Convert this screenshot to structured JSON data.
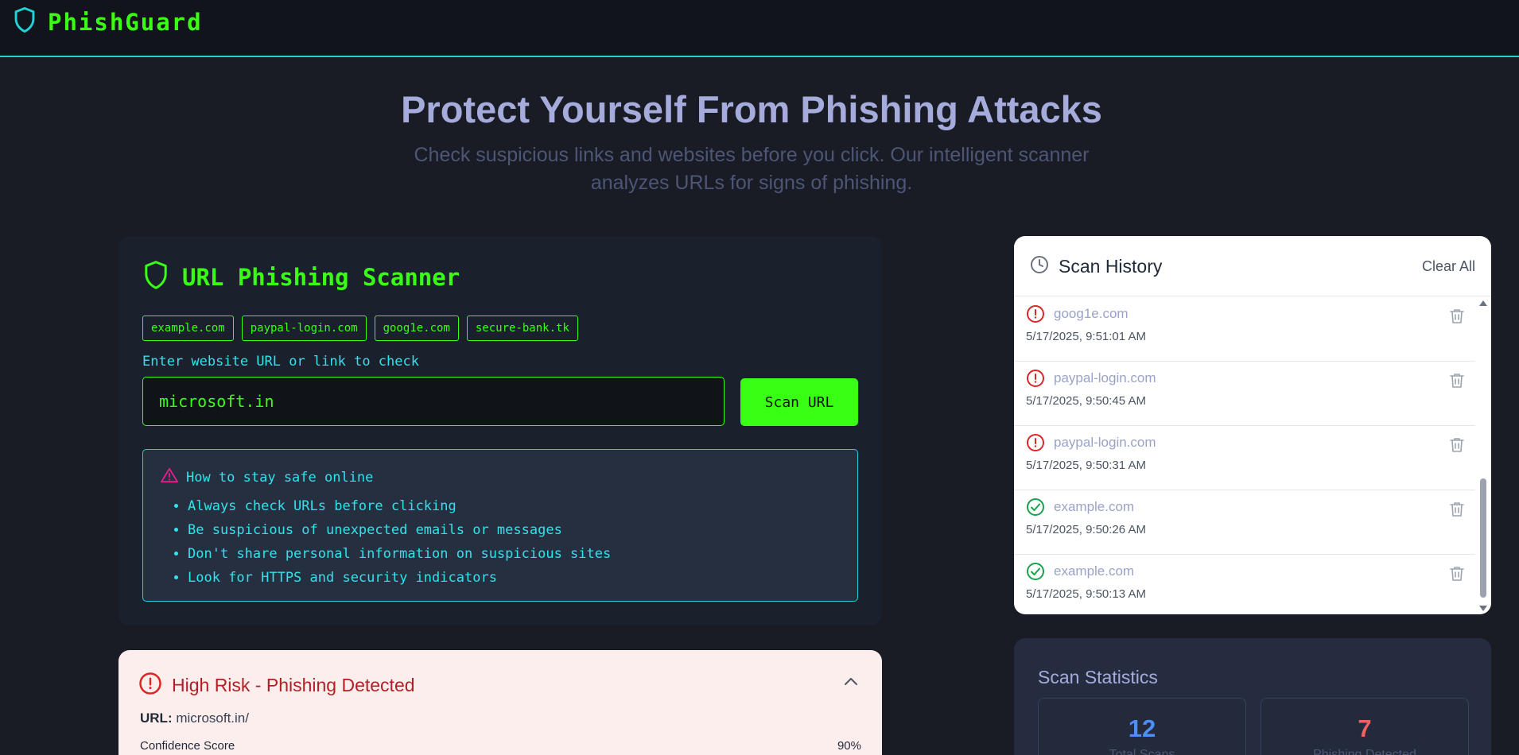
{
  "header": {
    "brand": "PhishGuard",
    "icon": "shield-icon"
  },
  "hero": {
    "title": "Protect Yourself From Phishing Attacks",
    "subtitle": "Check suspicious links and websites before you click. Our intelligent scanner analyzes URLs for signs of phishing."
  },
  "scanner": {
    "title": "URL Phishing Scanner",
    "examples": [
      "example.com",
      "paypal-login.com",
      "goog1e.com",
      "secure-bank.tk"
    ],
    "input_label": "Enter website URL or link to check",
    "input_value": "microsoft.in",
    "scan_button": "Scan URL",
    "tips_title": "How to stay safe online",
    "tips": [
      "Always check URLs before clicking",
      "Be suspicious of unexpected emails or messages",
      "Don't share personal information on suspicious sites",
      "Look for HTTPS and security indicators"
    ]
  },
  "result": {
    "title": "High Risk - Phishing Detected",
    "url_label": "URL:",
    "url_value": "microsoft.in/",
    "confidence_label": "Confidence Score",
    "confidence_value": "90%"
  },
  "history": {
    "title": "Scan History",
    "clear_all": "Clear All",
    "items": [
      {
        "domain": "goog1e.com",
        "time": "5/17/2025, 9:51:01 AM",
        "status": "phishing"
      },
      {
        "domain": "paypal-login.com",
        "time": "5/17/2025, 9:50:45 AM",
        "status": "phishing"
      },
      {
        "domain": "paypal-login.com",
        "time": "5/17/2025, 9:50:31 AM",
        "status": "phishing"
      },
      {
        "domain": "example.com",
        "time": "5/17/2025, 9:50:26 AM",
        "status": "safe"
      },
      {
        "domain": "example.com",
        "time": "5/17/2025, 9:50:13 AM",
        "status": "safe"
      }
    ]
  },
  "stats": {
    "title": "Scan Statistics",
    "total_scans": "12",
    "total_scans_label": "Total Scans",
    "phishing_detected": "7",
    "phishing_detected_label": "Phishing Detected"
  },
  "colors": {
    "accent_green": "#39ff14",
    "accent_cyan": "#1fd3d8",
    "danger": "#dc2626",
    "safe": "#16a34a"
  }
}
